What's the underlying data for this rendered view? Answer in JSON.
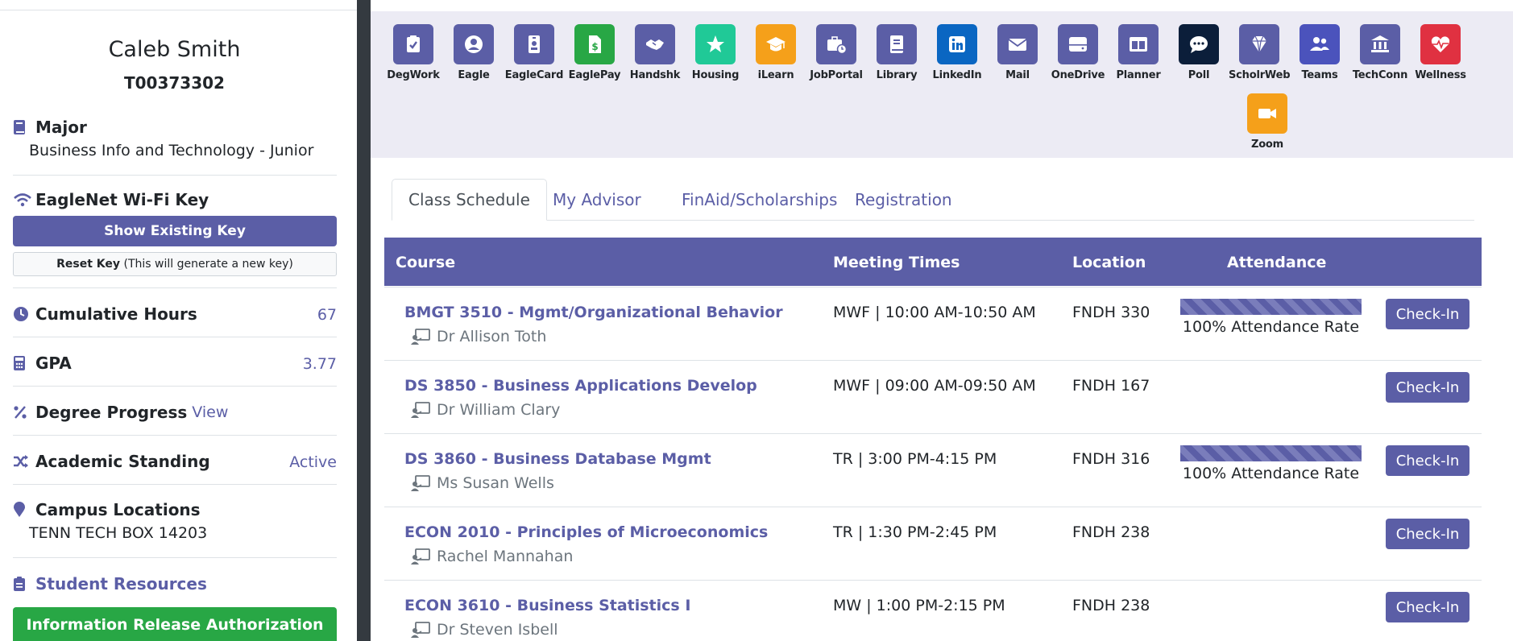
{
  "student": {
    "name": "Caleb Smith",
    "tnumber": "T00373302",
    "major_label": "Major",
    "major_value": "Business Info and Technology - Junior",
    "wifi_label": "EagleNet Wi-Fi Key",
    "show_key_button": "Show Existing Key",
    "reset_key_bold": "Reset Key",
    "reset_key_note": "(This will generate a new key)",
    "hours_label": "Cumulative Hours",
    "hours_value": "67",
    "gpa_label": "GPA",
    "gpa_value": "3.77",
    "degree_label": "Degree Progress",
    "degree_link": "View",
    "standing_label": "Academic Standing",
    "standing_value": "Active",
    "campus_label": "Campus Locations",
    "campus_value": "TENN TECH BOX 14203",
    "resources_link": "Student Resources",
    "info_release_button": "Information Release Authorization"
  },
  "apps": [
    {
      "label": "DegWork",
      "icon": "clipboard-check-icon",
      "color": "#5b5ea6"
    },
    {
      "label": "Eagle",
      "icon": "user-circle-icon",
      "color": "#5b5ea6"
    },
    {
      "label": "EagleCard",
      "icon": "id-badge-icon",
      "color": "#5b5ea6"
    },
    {
      "label": "EaglePay",
      "icon": "dollar-file-icon",
      "color": "#28a745"
    },
    {
      "label": "Handshk",
      "icon": "handshake-icon",
      "color": "#5b5ea6"
    },
    {
      "label": "Housing",
      "icon": "star-icon",
      "color": "#20c997"
    },
    {
      "label": "iLearn",
      "icon": "graduation-cap-icon",
      "color": "#f5a01a"
    },
    {
      "label": "JobPortal",
      "icon": "briefcase-clock-icon",
      "color": "#5b5ea6"
    },
    {
      "label": "Library",
      "icon": "book-icon",
      "color": "#5b5ea6"
    },
    {
      "label": "LinkedIn",
      "icon": "linkedin-icon",
      "color": "#0a66c2"
    },
    {
      "label": "Mail",
      "icon": "envelope-icon",
      "color": "#5b5ea6"
    },
    {
      "label": "OneDrive",
      "icon": "hard-drive-icon",
      "color": "#5b5ea6"
    },
    {
      "label": "Planner",
      "icon": "columns-icon",
      "color": "#5b5ea6"
    },
    {
      "label": "Poll",
      "icon": "comment-dots-icon",
      "color": "#0b1e3a"
    },
    {
      "label": "ScholrWeb",
      "icon": "gem-icon",
      "color": "#5b5ea6"
    },
    {
      "label": "Teams",
      "icon": "users-icon",
      "color": "#4b53bc"
    },
    {
      "label": "TechConn",
      "icon": "building-columns-icon",
      "color": "#5b5ea6"
    },
    {
      "label": "Wellness",
      "icon": "heart-pulse-icon",
      "color": "#e03141"
    },
    {
      "label": "Zoom",
      "icon": "video-icon",
      "color": "#f5a01a"
    }
  ],
  "tabs": [
    "Class Schedule",
    "My Advisor",
    "FinAid/Scholarships",
    "Registration"
  ],
  "table": {
    "headers": [
      "Course",
      "Meeting Times",
      "Location",
      "Attendance"
    ],
    "checkin_label": "Check-In",
    "rows": [
      {
        "course": "BMGT 3510 - Mgmt/Organizational Behavior",
        "instructor": "Dr Allison Toth",
        "times": "MWF | 10:00 AM-10:50 AM",
        "location": "FNDH 330",
        "attendance": "100% Attendance Rate",
        "attendance_pct": 100
      },
      {
        "course": "DS 3850 - Business Applications Develop",
        "instructor": "Dr William Clary",
        "times": "MWF | 09:00 AM-09:50 AM",
        "location": "FNDH 167",
        "attendance": "",
        "attendance_pct": null
      },
      {
        "course": "DS 3860 - Business Database Mgmt",
        "instructor": "Ms Susan Wells",
        "times": "TR | 3:00 PM-4:15 PM",
        "location": "FNDH 316",
        "attendance": "100% Attendance Rate",
        "attendance_pct": 100
      },
      {
        "course": "ECON 2010 - Principles of Microeconomics",
        "instructor": " Rachel Mannahan",
        "times": "TR | 1:30 PM-2:45 PM",
        "location": "FNDH 238",
        "attendance": "",
        "attendance_pct": null
      },
      {
        "course": "ECON 3610 - Business Statistics I",
        "instructor": "Dr Steven Isbell",
        "times": "MW | 1:00 PM-2:15 PM",
        "location": "FNDH 238",
        "attendance": "",
        "attendance_pct": null
      }
    ]
  }
}
